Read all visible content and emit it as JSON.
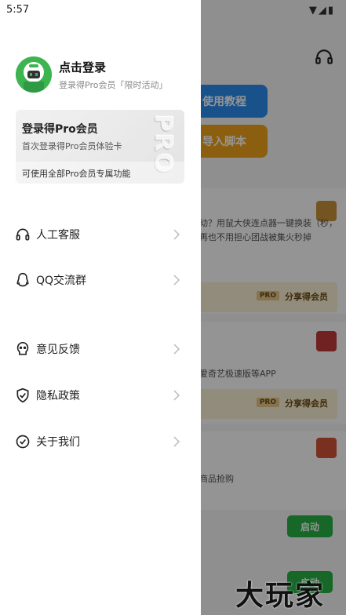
{
  "status_bar": {
    "time": "5:57"
  },
  "drawer": {
    "login_title": "点击登录",
    "login_subtitle": "登录得Pro会员「限时活动」",
    "pro_card": {
      "title": "登录得Pro会员",
      "subtitle": "首次登录得Pro会员体验卡",
      "footer": "可使用全部Pro会员专属功能",
      "badge": "PRO"
    },
    "menu": [
      {
        "label": "人工客服",
        "icon": "headset-icon"
      },
      {
        "label": "QQ交流群",
        "icon": "qq-penguin-icon"
      },
      {
        "label": "意见反馈",
        "icon": "feedback-icon"
      },
      {
        "label": "隐私政策",
        "icon": "shield-check-icon"
      },
      {
        "label": "关于我们",
        "icon": "about-badge-icon"
      }
    ]
  },
  "background": {
    "btn_tutorial": "使用教程",
    "btn_import": "导入脚本",
    "card1_text": "动？用鼠大侠连点器一键换装（秒，再也不用担心团战被集火秒掉",
    "share_label": "分享得会员",
    "pro_tag": "PRO",
    "card2_text": "爱奇艺极速版等APP",
    "card3_text": "商品抢购",
    "start_label": "启动",
    "watermark": "大玩家"
  },
  "colors": {
    "accent_blue": "#2c8cf0",
    "accent_orange": "#f1a21a",
    "green": "#28b446",
    "avatar_green": "#3cb450"
  }
}
